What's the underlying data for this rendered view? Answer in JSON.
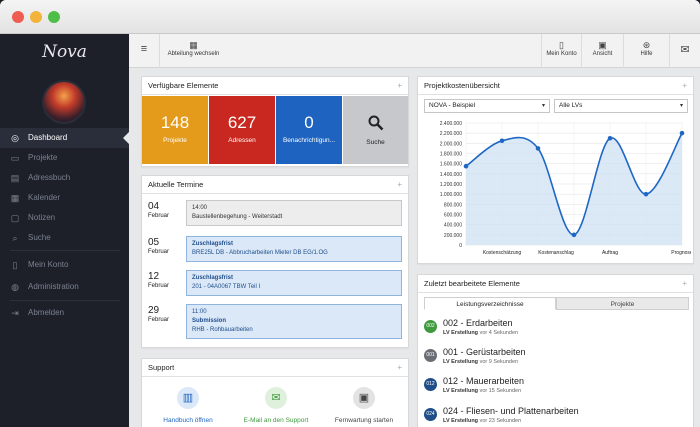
{
  "app": {
    "logo": "Nova"
  },
  "colors": {
    "sidebar_bg": "#1d2029",
    "tile_orange": "#e49a1a",
    "tile_red": "#c8281f",
    "tile_blue": "#1e63bf",
    "tile_grey": "#c6c8cc",
    "chart_line": "#1f67c4",
    "chart_fill": "#cfe1f3",
    "record_green": "#3e9a3c",
    "record_grey": "#6b6e75",
    "record_navy": "#1f4e8a"
  },
  "sidebar": {
    "items": [
      {
        "label": "Dashboard",
        "icon": "dashboard-icon",
        "glyph": "◎"
      },
      {
        "label": "Projekte",
        "icon": "folder-icon",
        "glyph": "▭"
      },
      {
        "label": "Adressbuch",
        "icon": "addressbook-icon",
        "glyph": "▤"
      },
      {
        "label": "Kalender",
        "icon": "calendar-icon",
        "glyph": "▦"
      },
      {
        "label": "Notizen",
        "icon": "notes-icon",
        "glyph": "▢"
      },
      {
        "label": "Suche",
        "icon": "search-icon",
        "glyph": "⌕"
      },
      {
        "label": "Mein Konto",
        "icon": "account-icon",
        "glyph": "▯"
      },
      {
        "label": "Administration",
        "icon": "admin-icon",
        "glyph": "◍"
      },
      {
        "label": "Abmelden",
        "icon": "logout-icon",
        "glyph": "⇥"
      }
    ]
  },
  "toolbar": {
    "menu_icon": "hamburger-icon",
    "department": {
      "label": "Abteilung wechseln",
      "icon": "building-icon"
    },
    "account": {
      "label": "Mein Konto",
      "icon": "phone-icon"
    },
    "view": {
      "label": "Ansicht",
      "icon": "view-icon"
    },
    "help": {
      "label": "Hilfe",
      "icon": "lifebuoy-icon"
    },
    "chat_icon": "chat-icon"
  },
  "available": {
    "title": "Verfügbare Elemente",
    "tiles": [
      {
        "value": "148",
        "label": "Projekte"
      },
      {
        "value": "627",
        "label": "Adressen"
      },
      {
        "value": "0",
        "label": "Benachrichtigun..."
      },
      {
        "value": "",
        "label": "Suche",
        "icon": "magnifier-icon"
      }
    ]
  },
  "appointments": {
    "title": "Aktuelle Termine",
    "items": [
      {
        "day": "04",
        "month": "Februar",
        "line1": "14:00",
        "line2": "Baustellenbegehung - Weiterstadt",
        "style": "grey"
      },
      {
        "day": "05",
        "month": "Februar",
        "line1": "Zuschlagsfrist",
        "line2": "BRE25L DB - Abbrucharbeiten Mieter DB EG/1.OG",
        "style": "blue"
      },
      {
        "day": "12",
        "month": "Februar",
        "line1": "Zuschlagsfrist",
        "line2": "201 - 04A0067 TBW Teil I",
        "style": "blue"
      },
      {
        "day": "29",
        "month": "Februar",
        "line1": "11:00",
        "line2": "Submission",
        "line3": "RHB - Rohbauarbeiten",
        "style": "blue"
      }
    ]
  },
  "support": {
    "title": "Support",
    "items": [
      {
        "label": "Handbuch öffnen",
        "icon": "book-icon",
        "color": "#1e63bf"
      },
      {
        "label": "E-Mail an den Support",
        "icon": "mail-icon",
        "color": "#3e9a3c"
      },
      {
        "label": "Fernwartung starten",
        "icon": "remote-icon",
        "color": "#444444"
      }
    ]
  },
  "costs": {
    "title": "Projektkostenübersicht",
    "project_select": "NOVA - Beispiel",
    "lv_select": "Alle LVs"
  },
  "chart_data": {
    "type": "line",
    "categories": [
      "Kostenschätzung",
      "Kostenanschlag",
      "Auftrag",
      "Prognose"
    ],
    "x": [
      0,
      1,
      2,
      3,
      4,
      5,
      6
    ],
    "values": [
      1550000,
      2050000,
      1900000,
      200000,
      2100000,
      1000000,
      2200000
    ],
    "ylim": [
      0,
      2400000
    ],
    "yticks": [
      "0",
      "200.000",
      "400.000",
      "600.000",
      "800.000",
      "1.000.000",
      "1.200.000",
      "1.400.000",
      "1.600.000",
      "1.800.000",
      "2.000.000",
      "2.200.000",
      "2.400.000"
    ],
    "grid": true,
    "title": "",
    "xlabel": "",
    "ylabel": ""
  },
  "recent": {
    "title": "Zuletzt bearbeitete Elemente",
    "tabs": [
      "Leistungsverzeichnisse",
      "Projekte"
    ],
    "items": [
      {
        "code": "002",
        "title": "002 - Erdarbeiten",
        "sub_bold": "LV Erstellung",
        "sub": "vor 4 Sekunden",
        "color": "#3e9a3c"
      },
      {
        "code": "001",
        "title": "001 - Gerüstarbeiten",
        "sub_bold": "LV Erstellung",
        "sub": "vor 9 Sekunden",
        "color": "#6b6e75"
      },
      {
        "code": "012",
        "title": "012 - Mauerarbeiten",
        "sub_bold": "LV Erstellung",
        "sub": "vor 15 Sekunden",
        "color": "#1f4e8a"
      },
      {
        "code": "024",
        "title": "024 - Fliesen- und Plattenarbeiten",
        "sub_bold": "LV Erstellung",
        "sub": "vor 23 Sekunden",
        "color": "#1f4e8a"
      }
    ]
  }
}
